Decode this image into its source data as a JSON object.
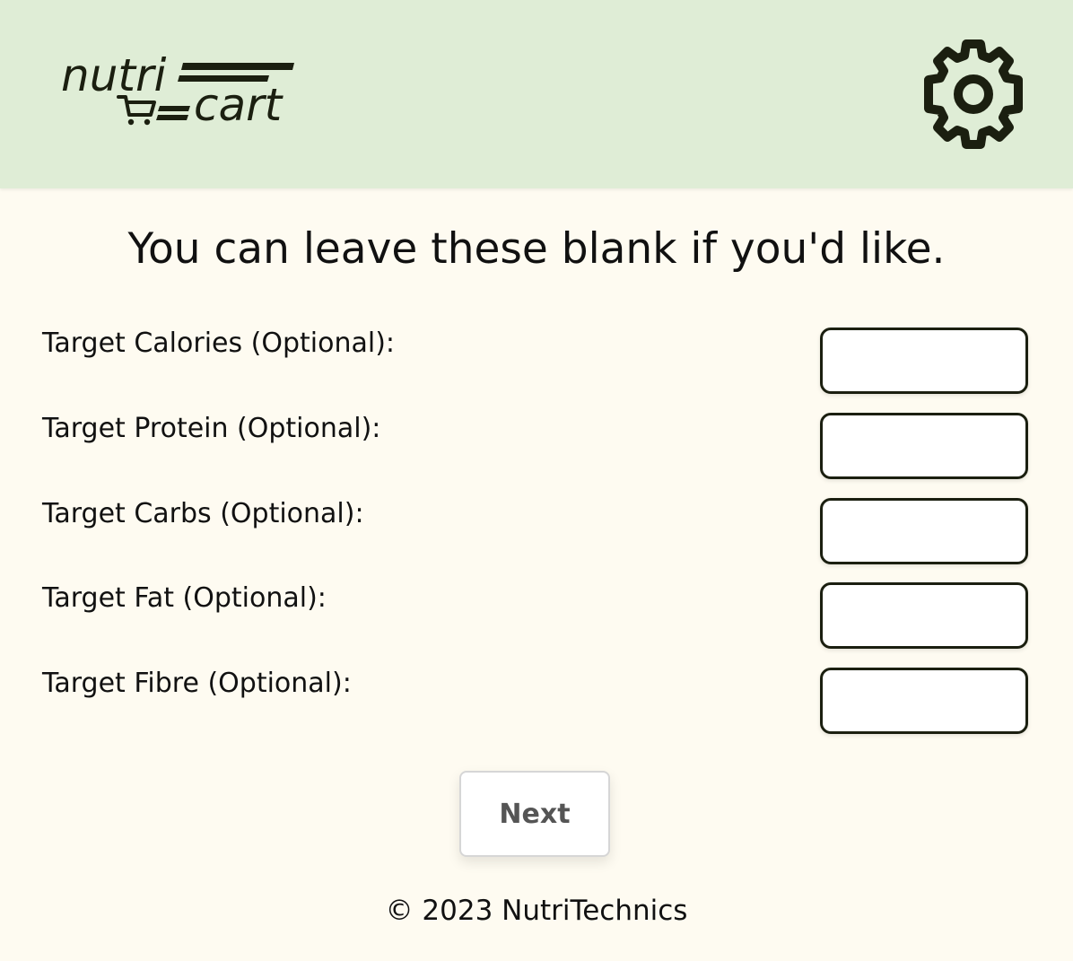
{
  "header": {
    "logo": {
      "word_top": "nutri",
      "word_bottom": "cart",
      "ink_color": "#1b1f10"
    },
    "settings_icon": "gear-icon",
    "background_color": "#dfedd6"
  },
  "main": {
    "subtitle": "You can leave these blank if you'd like.",
    "fields": [
      {
        "label": "Target Calories (Optional):",
        "value": ""
      },
      {
        "label": "Target Protein (Optional):",
        "value": ""
      },
      {
        "label": "Target Carbs (Optional):",
        "value": ""
      },
      {
        "label": "Target Fat (Optional):",
        "value": ""
      },
      {
        "label": "Target Fibre (Optional):",
        "value": ""
      }
    ],
    "next_label": "Next",
    "background_color": "#fefbf1"
  },
  "footer": {
    "text": "© 2023 NutriTechnics"
  }
}
